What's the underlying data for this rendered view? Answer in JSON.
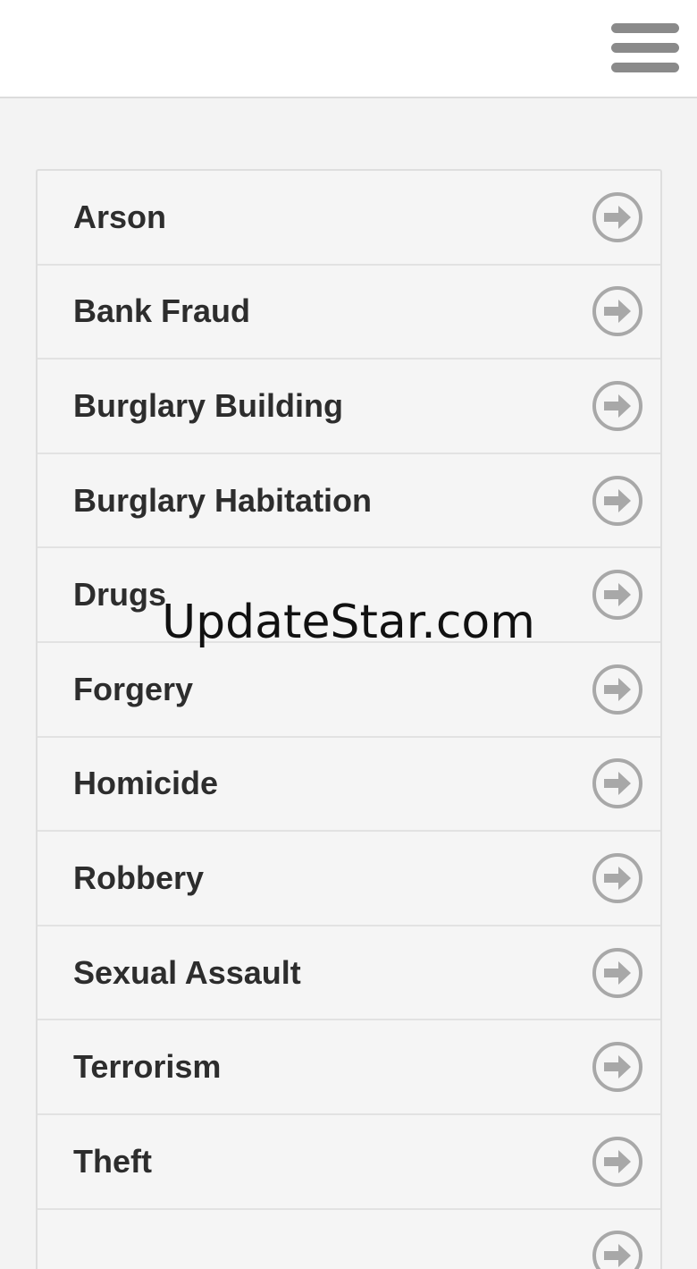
{
  "header": {
    "menu_icon": "hamburger-menu-icon"
  },
  "categories": [
    {
      "label": "Arson",
      "icon": "arrow-right-circle-icon"
    },
    {
      "label": "Bank Fraud",
      "icon": "arrow-right-circle-icon"
    },
    {
      "label": "Burglary Building",
      "icon": "arrow-right-circle-icon"
    },
    {
      "label": "Burglary Habitation",
      "icon": "arrow-right-circle-icon"
    },
    {
      "label": "Drugs",
      "icon": "arrow-right-circle-icon"
    },
    {
      "label": "Forgery",
      "icon": "arrow-right-circle-icon"
    },
    {
      "label": "Homicide",
      "icon": "arrow-right-circle-icon"
    },
    {
      "label": "Robbery",
      "icon": "arrow-right-circle-icon"
    },
    {
      "label": "Sexual Assault",
      "icon": "arrow-right-circle-icon"
    },
    {
      "label": "Terrorism",
      "icon": "arrow-right-circle-icon"
    },
    {
      "label": "Theft",
      "icon": "arrow-right-circle-icon"
    },
    {
      "label": "",
      "icon": "arrow-right-circle-icon"
    }
  ],
  "watermark": "UpdateStar.com",
  "colors": {
    "background": "#f3f3f3",
    "topbar": "#ffffff",
    "row_background": "#f5f5f5",
    "label_text": "#2d2d2d",
    "icon_gray": "#a8a8a8"
  }
}
